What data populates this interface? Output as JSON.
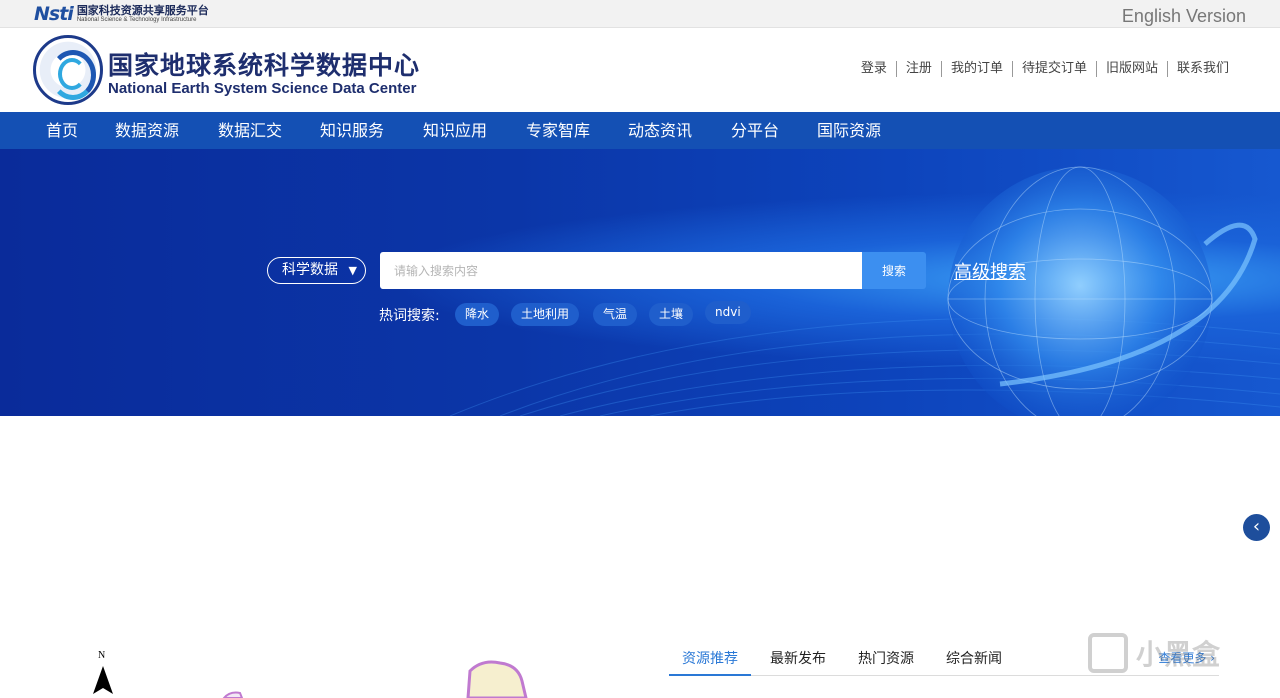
{
  "top_strip": {
    "nsti_logo_mark": "Nsti",
    "nsti_name_cn": "国家科技资源共享服务平台",
    "nsti_name_en": "National Science & Technology Infrastructure",
    "english_version": "English Version"
  },
  "header": {
    "title_cn": "国家地球系统科学数据中心",
    "title_en": "National Earth System Science Data Center",
    "user_links": [
      "登录",
      "注册",
      "我的订单",
      "待提交订单",
      "旧版网站",
      "联系我们"
    ]
  },
  "nav": {
    "items": [
      "首页",
      "数据资源",
      "数据汇交",
      "知识服务",
      "知识应用",
      "专家智库",
      "动态资讯",
      "分平台",
      "国际资源"
    ]
  },
  "search": {
    "category": "科学数据",
    "caret": "▼",
    "placeholder": "请输入搜索内容",
    "value": "",
    "button_label": "搜索",
    "advanced_label": "高级搜索",
    "hot_label": "热词搜索:",
    "hot_tags": [
      "降水",
      "土地利用",
      "气温",
      "土壤",
      "ndvi"
    ]
  },
  "side": {
    "collapse_icon": "‹"
  },
  "map": {
    "north_label": "N"
  },
  "tabs": {
    "items": [
      "资源推荐",
      "最新发布",
      "热门资源",
      "综合新闻"
    ],
    "active_index": 0,
    "see_more": "查看更多 ›"
  },
  "watermark": {
    "text": "小黑盒"
  },
  "colors": {
    "nav_bg": "#1450b4",
    "hero_bg": "#0b36a8",
    "search_button": "#3c8ff0",
    "accent": "#2a78d6",
    "title_color": "#1e2e6e"
  }
}
